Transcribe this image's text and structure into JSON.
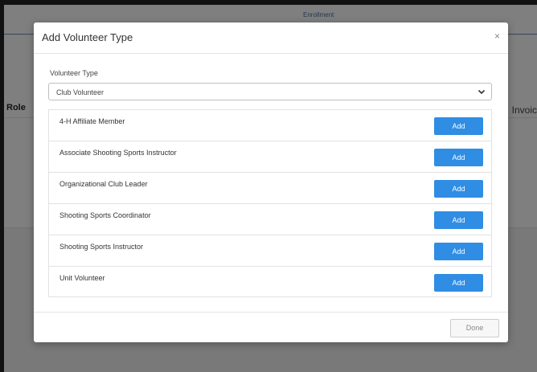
{
  "background": {
    "tab_label": "Enrollment",
    "col_role": "Role",
    "col_invoice": "Invoic"
  },
  "modal": {
    "title": "Add Volunteer Type",
    "close_glyph": "×",
    "volunteer_type_label": "Volunteer Type",
    "volunteer_type_selected": "Club Volunteer",
    "items": [
      {
        "label": "4-H Affiliate Member",
        "action": "Add"
      },
      {
        "label": "Associate Shooting Sports Instructor",
        "action": "Add"
      },
      {
        "label": "Organizational Club Leader",
        "action": "Add"
      },
      {
        "label": "Shooting Sports Coordinator",
        "action": "Add"
      },
      {
        "label": "Shooting Sports Instructor",
        "action": "Add"
      },
      {
        "label": "Unit Volunteer",
        "action": "Add"
      }
    ],
    "done_label": "Done"
  },
  "colors": {
    "accent": "#2f8de4",
    "overlay": "rgba(0,0,0,0.5)"
  },
  "icons": {
    "close": "close-icon",
    "dropdown": "chevron-down-icon"
  }
}
